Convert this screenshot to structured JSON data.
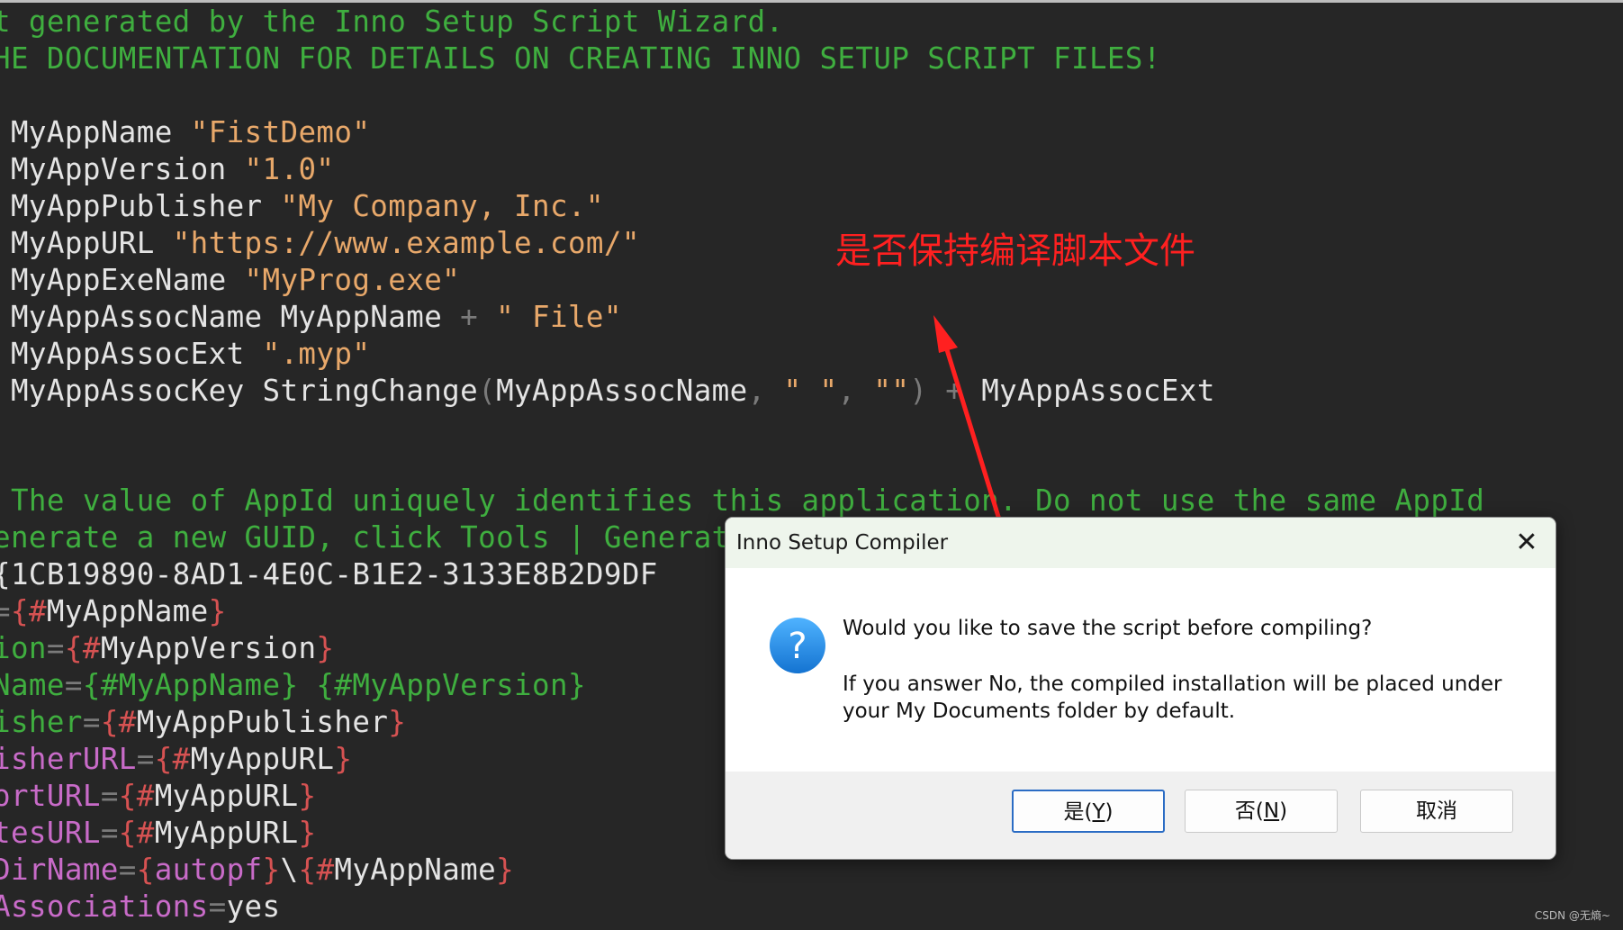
{
  "editor": {
    "comment_line_1": "t generated by the Inno Setup Script Wizard.",
    "comment_line_2": "HE DOCUMENTATION FOR DETAILS ON CREATING INNO SETUP SCRIPT FILES!",
    "defines": [
      {
        "name": " MyAppName ",
        "value": "\"FistDemo\""
      },
      {
        "name": " MyAppVersion ",
        "value": "\"1.0\""
      },
      {
        "name": " MyAppPublisher ",
        "value": "\"My Company, Inc.\""
      },
      {
        "name": " MyAppURL ",
        "value": "\"https://www.example.com/\""
      },
      {
        "name": " MyAppExeName ",
        "value": "\"MyProg.exe\""
      }
    ],
    "assoc_name_line": {
      "name": " MyAppAssocName MyAppName ",
      "op": "+",
      "value": " \" File\""
    },
    "assoc_ext_line": {
      "name": " MyAppAssocExt ",
      "value": "\".myp\""
    },
    "assoc_key_line": {
      "name": " MyAppAssocKey StringChange",
      "paren_open": "(",
      "arg1": "MyAppAssocName",
      "comma": ",",
      "arg2": " \" \"",
      "comma2": ",",
      "arg3": " \"\"",
      "paren_close": ")",
      "op": " + ",
      "tail": "MyAppAssocExt"
    },
    "comment_line_3": " The value of AppId uniquely identifies this application. Do not use the same AppId",
    "comment_line_4": "enerate a new GUID, click Tools | Generate GUID inside the IDE.)",
    "appid_line": "{1CB19890-8AD1-4E0C-B1E2-3133E8B2D9DF",
    "setup_lines": [
      {
        "key": "",
        "eq": "=",
        "open": "{",
        "hash": "#",
        "val": "MyAppName",
        "close": "}"
      },
      {
        "key": "ion",
        "eq": "=",
        "open": "{",
        "hash": "#",
        "val": "MyAppVersion",
        "close": "}"
      },
      {
        "key": "Name",
        "eq": "=",
        "open": "{",
        "hash": "#",
        "val": "MyAppName",
        "close": "}",
        "extra": " {#MyAppVersion}"
      },
      {
        "key": "isher",
        "eq": "=",
        "open": "{",
        "hash": "#",
        "val": "MyAppPublisher",
        "close": "}"
      },
      {
        "key": "isherURL",
        "eq": "=",
        "open": "{",
        "hash": "#",
        "val": "MyAppURL",
        "close": "}"
      },
      {
        "key": "ortURL",
        "eq": "=",
        "open": "{",
        "hash": "#",
        "val": "MyAppURL",
        "close": "}"
      },
      {
        "key": "tesURL",
        "eq": "=",
        "open": "{",
        "hash": "#",
        "val": "MyAppURL",
        "close": "}"
      }
    ],
    "dirname_line": {
      "key": "DirName",
      "eq": "=",
      "open": "{",
      "const": "autopf",
      "close": "}",
      "sep": "\\",
      "open2": "{",
      "hash": "#",
      "val": "MyAppName",
      "close2": "}"
    },
    "assoc_line": {
      "key": "Associations",
      "eq": "=",
      "val": "yes"
    }
  },
  "annotation": {
    "text": "是否保持编译脚本文件",
    "color": "#ff2020"
  },
  "dialog": {
    "title": "Inno Setup Compiler",
    "close_glyph": "✕",
    "icon": "question-icon",
    "message": "Would you like to save the script before compiling?",
    "detail": "If you answer No, the compiled installation will be placed under your My Documents folder by default.",
    "buttons": {
      "yes_prefix": "是(",
      "yes_key": "Y",
      "yes_suffix": ")",
      "no_prefix": "否(",
      "no_key": "N",
      "no_suffix": ")",
      "cancel": "取消"
    }
  },
  "watermark": "CSDN @无熵~",
  "colors": {
    "background": "#262626",
    "comment": "#3fae3f",
    "string": "#e8a86a",
    "brace": "#d65252",
    "constant": "#c86bc8",
    "accent": "#2b6cc4"
  }
}
